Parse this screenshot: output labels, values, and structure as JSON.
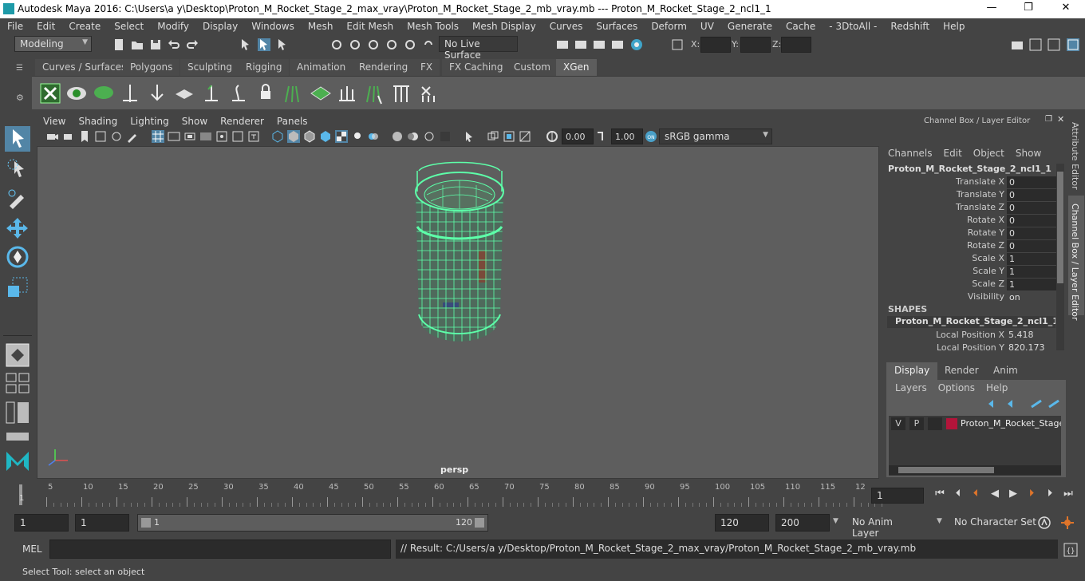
{
  "window": {
    "title": "Autodesk Maya 2016: C:\\Users\\a y\\Desktop\\Proton_M_Rocket_Stage_2_max_vray\\Proton_M_Rocket_Stage_2_mb_vray.mb   ---   Proton_M_Rocket_Stage_2_ncl1_1",
    "minimize": "—",
    "restore": "❐",
    "close": "✕"
  },
  "menubar": [
    "File",
    "Edit",
    "Create",
    "Select",
    "Modify",
    "Display",
    "Windows",
    "Mesh",
    "Edit Mesh",
    "Mesh Tools",
    "Mesh Display",
    "Curves",
    "Surfaces",
    "Deform",
    "UV",
    "Generate",
    "Cache",
    "- 3DtoAll -",
    "Redshift",
    "Help"
  ],
  "statusline": {
    "mode": "Modeling",
    "live_surface": "No Live Surface",
    "x_label": "X:",
    "y_label": "Y:",
    "z_label": "Z:"
  },
  "shelf_tabs": [
    "Curves / Surfaces",
    "Polygons",
    "Sculpting",
    "Rigging",
    "Animation",
    "Rendering",
    "FX",
    "FX Caching",
    "Custom",
    "XGen"
  ],
  "viewport": {
    "menu": [
      "View",
      "Shading",
      "Lighting",
      "Show",
      "Renderer",
      "Panels"
    ],
    "exposure": "0.00",
    "gamma": "1.00",
    "colorspace": "sRGB gamma",
    "camera": "persp"
  },
  "channel_box": {
    "title": "Channel Box / Layer Editor",
    "menu": [
      "Channels",
      "Edit",
      "Object",
      "Show"
    ],
    "object": "Proton_M_Rocket_Stage_2_ncl1_1",
    "channels": [
      {
        "label": "Translate X",
        "value": "0"
      },
      {
        "label": "Translate Y",
        "value": "0"
      },
      {
        "label": "Translate Z",
        "value": "0"
      },
      {
        "label": "Rotate X",
        "value": "0"
      },
      {
        "label": "Rotate Y",
        "value": "0"
      },
      {
        "label": "Rotate Z",
        "value": "0"
      },
      {
        "label": "Scale X",
        "value": "1"
      },
      {
        "label": "Scale Y",
        "value": "1"
      },
      {
        "label": "Scale Z",
        "value": "1"
      },
      {
        "label": "Visibility",
        "value": "on"
      }
    ],
    "shapes_header": "SHAPES",
    "shape_name": "Proton_M_Rocket_Stage_2_ncl1_1Sh...",
    "shape_channels": [
      {
        "label": "Local Position X",
        "value": "5.418"
      },
      {
        "label": "Local Position Y",
        "value": "820.173"
      }
    ],
    "tabs": [
      "Display",
      "Render",
      "Anim"
    ],
    "layer_menu": [
      "Layers",
      "Options",
      "Help"
    ],
    "layer": {
      "v": "V",
      "p": "P",
      "name": "Proton_M_Rocket_Stage",
      "color": "#b3143a"
    }
  },
  "side_tabs": [
    "Attribute Editor",
    "Channel Box / Layer Editor"
  ],
  "timeslider": {
    "ticks": [
      "5",
      "10",
      "15",
      "20",
      "25",
      "30",
      "35",
      "40",
      "45",
      "50",
      "55",
      "60",
      "65",
      "70",
      "75",
      "80",
      "85",
      "90",
      "95",
      "100",
      "105",
      "110",
      "115",
      "12"
    ],
    "start_marker": "1",
    "current_frame": "1"
  },
  "range": {
    "start": "1",
    "playback_start": "1",
    "slider_start": "1",
    "slider_end": "120",
    "playback_end": "120",
    "end": "200",
    "anim_layer": "No Anim Layer",
    "character_set": "No Character Set"
  },
  "cmdline": {
    "lang": "MEL",
    "result": "// Result: C:/Users/a y/Desktop/Proton_M_Rocket_Stage_2_max_vray/Proton_M_Rocket_Stage_2_mb_vray.mb"
  },
  "helpline": "Select Tool: select an object",
  "colors": {
    "wireframe": "#5dffa9",
    "accent": "#5285a6",
    "background": "#444444",
    "viewport": "#5e5e5e"
  }
}
